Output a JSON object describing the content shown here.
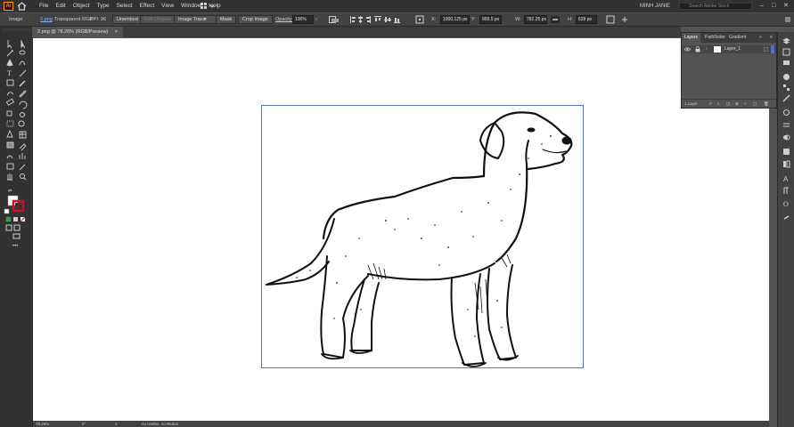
{
  "menubar": {
    "logo": "Ai",
    "items": [
      "File",
      "Edit",
      "Object",
      "Type",
      "Select",
      "Effect",
      "View",
      "Window",
      "Help"
    ],
    "user": "MINH JANIE",
    "search_placeholder": "Search Adobe Stock",
    "window_controls": [
      "–",
      "□",
      "✕"
    ]
  },
  "controlbar": {
    "selection_type": "Image",
    "file_name": "2.png",
    "file_info": "Transparent RGB",
    "ppi": "PPI: 96",
    "embed_label": "Unembed",
    "edit_original_label": "Edit Original",
    "image_trace_label": "Image Trace",
    "mask_label": "Mask",
    "crop_image_label": "Crop Image",
    "opacity_label": "Opacity:",
    "opacity_value": "100%",
    "x_label": "X:",
    "x_value": "1000.125 px",
    "y_label": "Y:",
    "y_value": "999.5 px",
    "w_label": "W:",
    "w_value": "782.25 px",
    "h_label": "H:",
    "h_value": "639 px"
  },
  "document": {
    "tab_title": "2.png @ 78.26% (RGB/Preview)",
    "close_symbol": "×"
  },
  "statusbar": {
    "zoom": "78.26%",
    "rotation": "0°",
    "artboard": "1",
    "status": "no Undos, no Redos"
  },
  "layers_panel": {
    "tabs": [
      "Layers",
      "Pathfinder",
      "Gradient"
    ],
    "active_tab": "Layers",
    "layer_name": "Layer_1",
    "footer_count": "1 Layer",
    "accent_color": "#4a6fd0"
  },
  "colors": {
    "app_bg": "#535353",
    "canvas": "#ffffff",
    "artboard_border": "#5b74c8",
    "fill_swatch": "#ffffff",
    "stroke_swatch": "#c8102e"
  }
}
